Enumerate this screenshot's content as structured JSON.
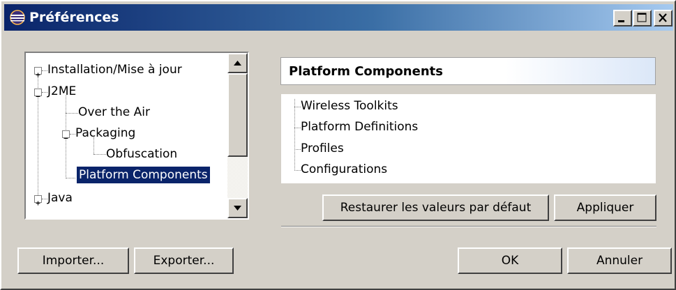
{
  "window": {
    "title": "Préférences",
    "minimize_label": "_",
    "maximize_label": "□",
    "close_label": "×"
  },
  "tree": {
    "items": [
      {
        "label": "Installation/Mise à jour",
        "expander": "+"
      },
      {
        "label": "J2ME",
        "expander": "−"
      },
      {
        "label": "Over the Air"
      },
      {
        "label": "Packaging",
        "expander": "−"
      },
      {
        "label": "Obfuscation"
      },
      {
        "label": "Platform Components",
        "selected": true
      },
      {
        "label": "Java",
        "expander": "+"
      }
    ]
  },
  "page": {
    "header": "Platform Components",
    "components": [
      "Wireless Toolkits",
      "Platform Definitions",
      "Profiles",
      "Configurations"
    ],
    "restore_defaults": "Restaurer les valeurs par défaut",
    "apply": "Appliquer"
  },
  "footer": {
    "import": "Importer...",
    "export": "Exporter...",
    "ok": "OK",
    "cancel": "Annuler"
  },
  "colors": {
    "title_bar_start": "#0a246a",
    "selection": "#0a246a",
    "dialog_bg": "#d4d0c8"
  }
}
